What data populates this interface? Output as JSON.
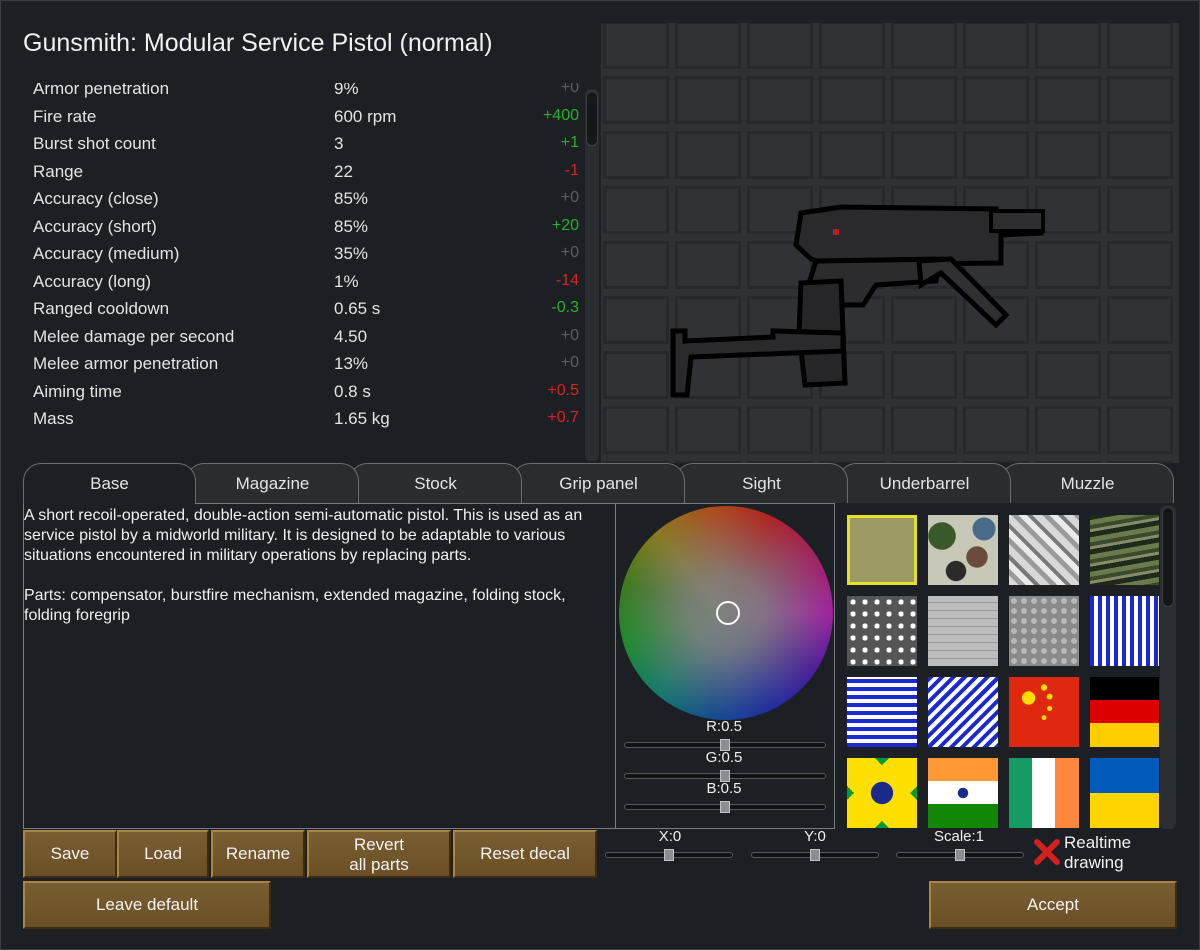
{
  "title": "Gunsmith: Modular Service Pistol (normal)",
  "stats": [
    {
      "label": "Armor penetration",
      "value": "9%",
      "delta": "+0",
      "sign": "zero"
    },
    {
      "label": "Fire rate",
      "value": "600 rpm",
      "delta": "+400",
      "sign": "pos"
    },
    {
      "label": "Burst shot count",
      "value": "3",
      "delta": "+1",
      "sign": "pos"
    },
    {
      "label": "Range",
      "value": "22",
      "delta": "-1",
      "sign": "neg"
    },
    {
      "label": "Accuracy (close)",
      "value": "85%",
      "delta": "+0",
      "sign": "zero"
    },
    {
      "label": "Accuracy (short)",
      "value": "85%",
      "delta": "+20",
      "sign": "pos"
    },
    {
      "label": "Accuracy (medium)",
      "value": "35%",
      "delta": "+0",
      "sign": "zero"
    },
    {
      "label": "Accuracy (long)",
      "value": "1%",
      "delta": "-14",
      "sign": "neg"
    },
    {
      "label": "Ranged cooldown",
      "value": "0.65 s",
      "delta": "-0.3",
      "sign": "pos"
    },
    {
      "label": "Melee damage per second",
      "value": "4.50",
      "delta": "+0",
      "sign": "zero"
    },
    {
      "label": "Melee armor penetration",
      "value": "13%",
      "delta": "+0",
      "sign": "zero"
    },
    {
      "label": "Aiming time",
      "value": "0.8 s",
      "delta": "+0.5",
      "sign": "neg"
    },
    {
      "label": "Mass",
      "value": "1.65 kg",
      "delta": "+0.7",
      "sign": "neg"
    }
  ],
  "tabs": [
    "Base",
    "Magazine",
    "Stock",
    "Grip panel",
    "Sight",
    "Underbarrel",
    "Muzzle"
  ],
  "active_tab": "Base",
  "description": {
    "para1": "A short recoil-operated, double-action semi-automatic pistol. This is used as an service pistol by a midworld military. It is designed to be adaptable to various situations encountered in military operations by replacing parts.",
    "para2": "Parts: compensator, burstfire mechanism, extended magazine, folding stock, folding foregrip"
  },
  "color": {
    "r_label": "R:0.5",
    "g_label": "G:0.5",
    "b_label": "B:0.5",
    "r": 0.5,
    "g": 0.5,
    "b": 0.5
  },
  "decals": [
    "plain-olive",
    "woodland-camo",
    "urban-camo",
    "tiger-stripe-camo",
    "cobblestone",
    "brick",
    "stone",
    "vertical-stripes-blue",
    "horizontal-stripes-blue",
    "diagonal-stripes-blue",
    "flag-china",
    "flag-germany",
    "flag-brazil",
    "flag-india",
    "flag-ireland",
    "flag-ukraine"
  ],
  "selected_decal": "plain-olive",
  "buttons": {
    "save": "Save",
    "load": "Load",
    "rename": "Rename",
    "revert_line1": "Revert",
    "revert_line2": "all parts",
    "reset_decal": "Reset decal",
    "leave_default": "Leave default",
    "accept": "Accept"
  },
  "decal_transform": {
    "x_label": "X:0",
    "y_label": "Y:0",
    "scale_label": "Scale:1",
    "x": 0,
    "y": 0,
    "scale": 1
  },
  "realtime": {
    "line1": "Realtime",
    "line2": "drawing",
    "enabled": false
  },
  "colors": {
    "positive": "#24b324",
    "negative": "#e02020",
    "neutral": "#5a5d62",
    "button": "#74582c",
    "selection": "#e6e02a"
  }
}
